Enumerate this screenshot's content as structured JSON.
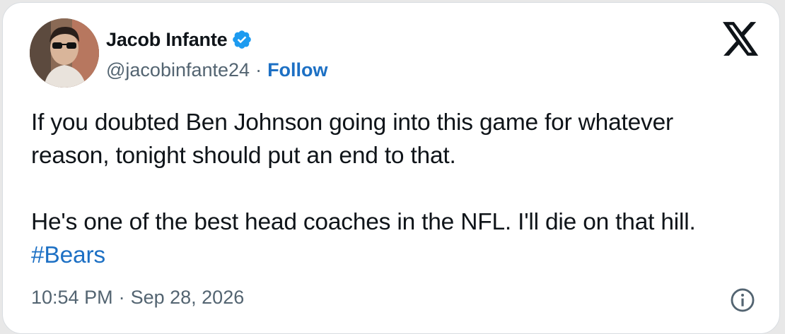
{
  "author": {
    "display_name": "Jacob Infante",
    "handle": "@jacobinfante24",
    "separator": "·",
    "follow_label": "Follow",
    "verified": true,
    "verified_color": "#1d9bf0"
  },
  "tweet": {
    "paragraph_1": "If you doubted Ben Johnson going into this game for whatever reason, tonight should put an end to that.",
    "paragraph_2_text": "He's one of the best head coaches in the NFL. I'll die on that hill. ",
    "hashtag": "#Bears",
    "link_color": "#1d70c4"
  },
  "meta": {
    "time": "10:54 PM",
    "separator": "·",
    "date": "Sep 28, 2026"
  },
  "icons": {
    "brand": "x-logo-icon",
    "info": "info-icon",
    "verified": "verified-badge-icon"
  }
}
